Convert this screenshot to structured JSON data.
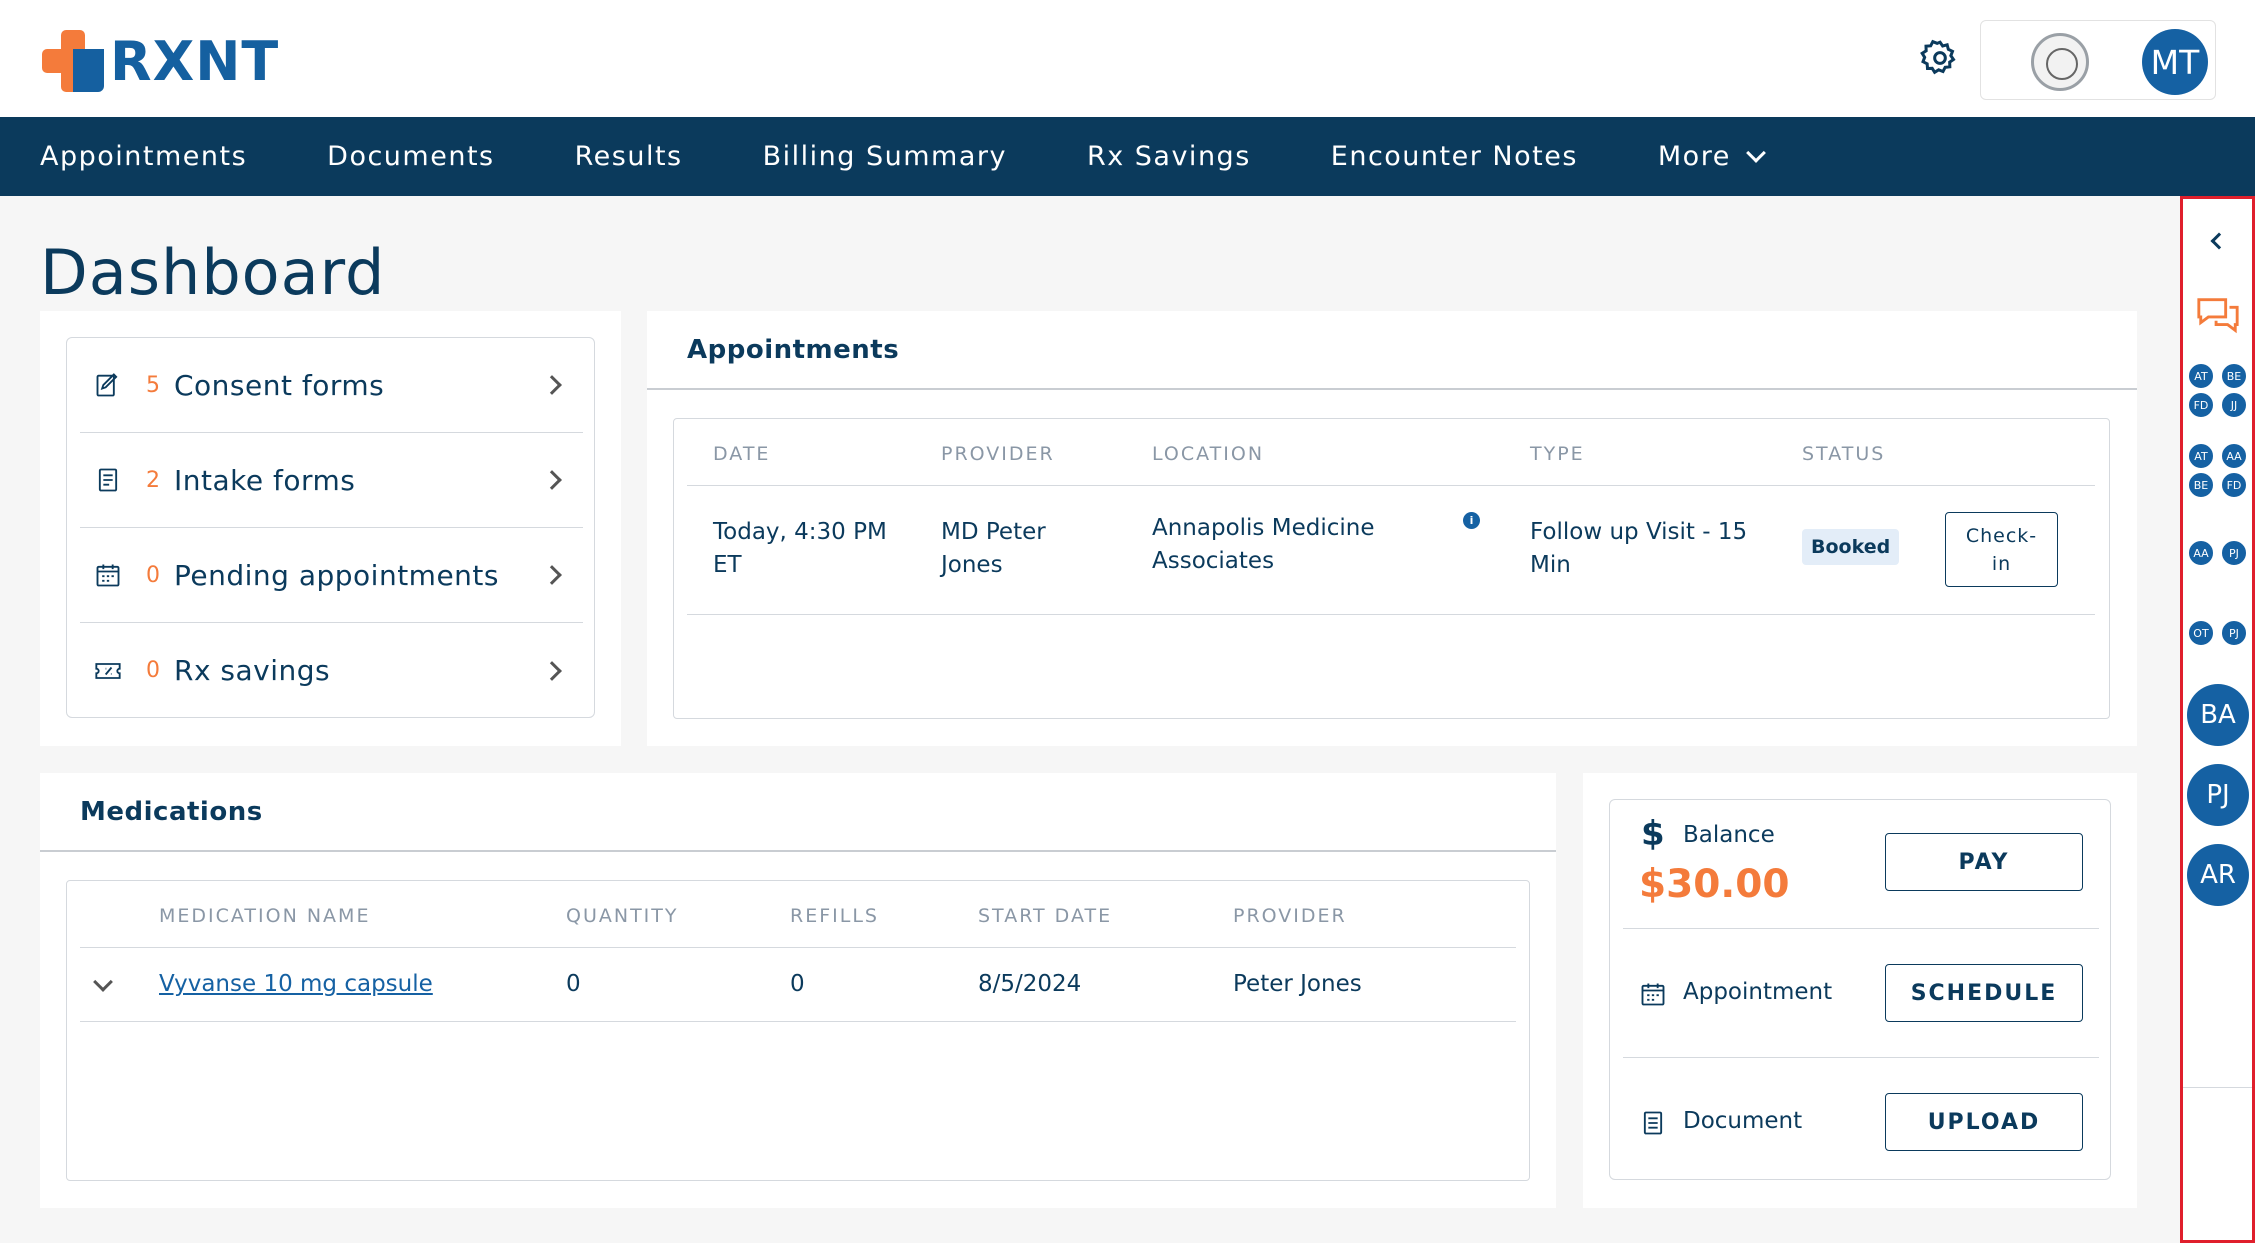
{
  "brand": {
    "name": "RXNT"
  },
  "header": {
    "user_initials": "MT"
  },
  "nav": {
    "items": [
      "Appointments",
      "Documents",
      "Results",
      "Billing Summary",
      "Rx Savings",
      "Encounter Notes"
    ],
    "more_label": "More"
  },
  "page": {
    "title": "Dashboard"
  },
  "summary": {
    "rows": [
      {
        "count": "5",
        "label": "Consent forms",
        "icon": "consent-form-icon"
      },
      {
        "count": "2",
        "label": "Intake forms",
        "icon": "intake-form-icon"
      },
      {
        "count": "0",
        "label": "Pending appointments",
        "icon": "calendar-icon"
      },
      {
        "count": "0",
        "label": "Rx savings",
        "icon": "rx-coupon-icon"
      }
    ]
  },
  "appointments": {
    "title": "Appointments",
    "columns": [
      "DATE",
      "PROVIDER",
      "LOCATION",
      "TYPE",
      "STATUS"
    ],
    "rows": [
      {
        "date_line1": "Today, 4:30 PM",
        "date_line2": "ET",
        "provider_line1": "MD Peter",
        "provider_line2": "Jones",
        "location_line1": "Annapolis Medicine",
        "location_line2": "Associates",
        "info_glyph": "i",
        "type_line1": "Follow up Visit - 15",
        "type_line2": "Min",
        "status": "Booked",
        "action_line1": "Check-",
        "action_line2": "in"
      }
    ]
  },
  "medications": {
    "title": "Medications",
    "columns": [
      "MEDICATION NAME",
      "QUANTITY",
      "REFILLS",
      "START DATE",
      "PROVIDER"
    ],
    "rows": [
      {
        "name": "Vyvanse 10 mg capsule",
        "quantity": "0",
        "refills": "0",
        "start_date": "8/5/2024",
        "provider": "Peter Jones"
      }
    ]
  },
  "actions": {
    "balance_label": "Balance",
    "balance_amount": "$30.00",
    "balance_symbol": "$",
    "pay_label": "PAY",
    "appointment_label": "Appointment",
    "schedule_label": "SCHEDULE",
    "document_label": "Document",
    "upload_label": "UPLOAD"
  },
  "rail": {
    "groups": [
      [
        "AT",
        "BE",
        "FD",
        "JJ"
      ],
      [
        "AT",
        "AA",
        "BE",
        "FD"
      ],
      [
        "AA",
        "PJ"
      ],
      [
        "OT",
        "PJ"
      ]
    ],
    "big_avatars": [
      "BA",
      "PJ",
      "AR"
    ]
  },
  "colors": {
    "navy": "#0b3a5c",
    "accent_orange": "#f47b3b",
    "brand_blue": "#1561a3",
    "rail_border": "#e01f2c"
  }
}
